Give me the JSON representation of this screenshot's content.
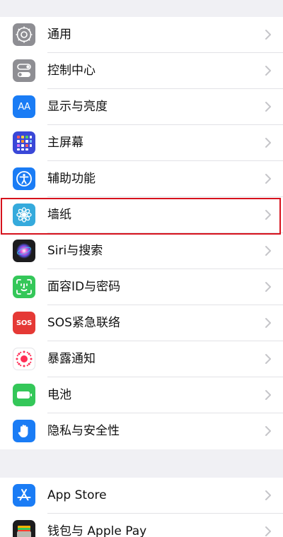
{
  "colors": {
    "page_background": "#f0f0f4",
    "row_background": "#ffffff",
    "separator": "#e2e2e6",
    "chevron": "#c5c5c9",
    "highlight": "#d6121d",
    "icon_gray": "#8e8e93",
    "icon_blue": "#1a7cf5",
    "icon_indigo": "#3a48d8",
    "icon_cyan": "#35aadc",
    "icon_green": "#34c759",
    "icon_red": "#e53935",
    "icon_dark": "#1c1c1e"
  },
  "settings_group_1": {
    "items": [
      {
        "label": "通用",
        "icon": "gear-icon",
        "icon_color": "#8e8e93"
      },
      {
        "label": "控制中心",
        "icon": "toggles-icon",
        "icon_color": "#8e8e93"
      },
      {
        "label": "显示与亮度",
        "icon": "aa-icon",
        "icon_color": "#1a7cf5",
        "icon_text": "AA"
      },
      {
        "label": "主屏幕",
        "icon": "home-screen-grid-icon",
        "icon_color": "#3a48d8"
      },
      {
        "label": "辅助功能",
        "icon": "accessibility-icon",
        "icon_color": "#1a7cf5"
      },
      {
        "label": "墙纸",
        "icon": "wallpaper-flower-icon",
        "icon_color": "#35aadc",
        "highlighted": true
      },
      {
        "label": "Siri与搜索",
        "icon": "siri-icon",
        "icon_color": "#1c1c1e"
      },
      {
        "label": "面容ID与密码",
        "icon": "face-id-icon",
        "icon_color": "#34c759"
      },
      {
        "label": "SOS紧急联络",
        "icon": "sos-icon",
        "icon_color": "#e53935",
        "icon_text": "SOS"
      },
      {
        "label": "暴露通知",
        "icon": "exposure-notification-icon",
        "icon_color": "#ffffff"
      },
      {
        "label": "电池",
        "icon": "battery-icon",
        "icon_color": "#34c759"
      },
      {
        "label": "隐私与安全性",
        "icon": "hand-icon",
        "icon_color": "#1a7cf5"
      }
    ]
  },
  "settings_group_2": {
    "items": [
      {
        "label": "App Store",
        "icon": "app-store-icon",
        "icon_color": "#1a7cf5"
      },
      {
        "label": "钱包与 Apple Pay",
        "icon": "wallet-icon",
        "icon_color": "#1c1c1e"
      }
    ]
  }
}
